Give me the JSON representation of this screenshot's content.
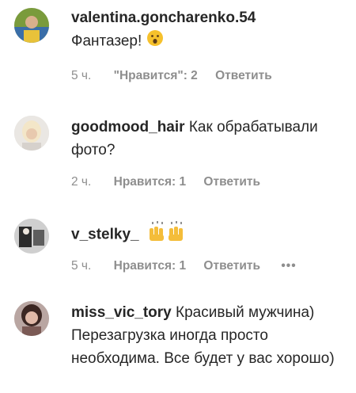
{
  "comments": [
    {
      "username": "valentina.goncharenko.54",
      "text": "Фантазер!",
      "time": "5 ч.",
      "likes": "\"Нравится\": 2",
      "reply": "Ответить"
    },
    {
      "username": "goodmood_hair",
      "text": "Как обрабатывали фото?",
      "time": "2 ч.",
      "likes": "Нравится: 1",
      "reply": "Ответить"
    },
    {
      "username": "v_stelky_",
      "text": "",
      "time": "5 ч.",
      "likes": "Нравится: 1",
      "reply": "Ответить",
      "more": "•••"
    },
    {
      "username": "miss_vic_tory",
      "text": "Красивый мужчина) Перезагрузка иногда просто необходима. Все будет у вас хорошо)",
      "time": "",
      "likes": "",
      "reply": ""
    }
  ],
  "icons": {
    "surprised": "surprised-face-emoji",
    "raised_hands": "raising-hands-emoji",
    "more": "more-options-icon"
  }
}
